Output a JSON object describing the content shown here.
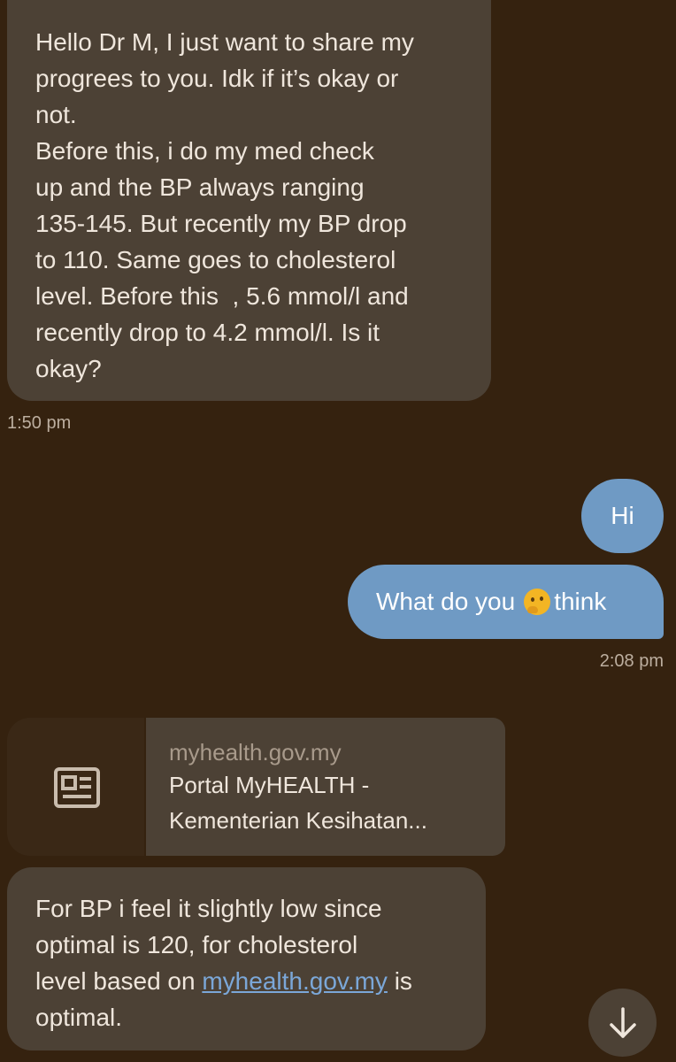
{
  "messages": {
    "incoming_1": {
      "lines": [
        "Hello Dr M, I just want to share my",
        "progrees to you. Idk if it’s okay or",
        "not.",
        "Before this, i do my med check",
        "up and the BP always ranging",
        "135-145. But recently my BP drop",
        "to 110. Same goes to cholesterol",
        "level. Before this  , 5.6 mmol/l and",
        "recently drop to 4.2 mmol/l. Is it",
        "okay?"
      ],
      "time": "1:50 pm"
    },
    "outgoing_1": {
      "text": "Hi"
    },
    "outgoing_2": {
      "text_before": "What do you",
      "emoji_icon": "thinking-face-emoji",
      "text_after": "think",
      "time": "2:08 pm"
    },
    "link_preview": {
      "icon": "newspaper-icon",
      "domain": "myhealth.gov.my",
      "title_line_1": "Portal MyHEALTH -",
      "title_line_2": "Kementerian Kesihatan..."
    },
    "incoming_2": {
      "line_1": "For BP i feel it slightly low since",
      "line_2": "optimal is 120, for cholesterol",
      "line_3_before": "level based on ",
      "line_3_link": "myhealth.gov.my",
      "line_3_after": " is",
      "line_4": "optimal."
    }
  },
  "scroll_button": {
    "icon": "arrow-down-icon"
  },
  "colors": {
    "background": "#35220f",
    "incoming_bubble": "#4c4135",
    "outgoing_bubble": "#6f9ac4",
    "link_text": "#7ba7d8",
    "timestamp": "#bcae9f"
  }
}
